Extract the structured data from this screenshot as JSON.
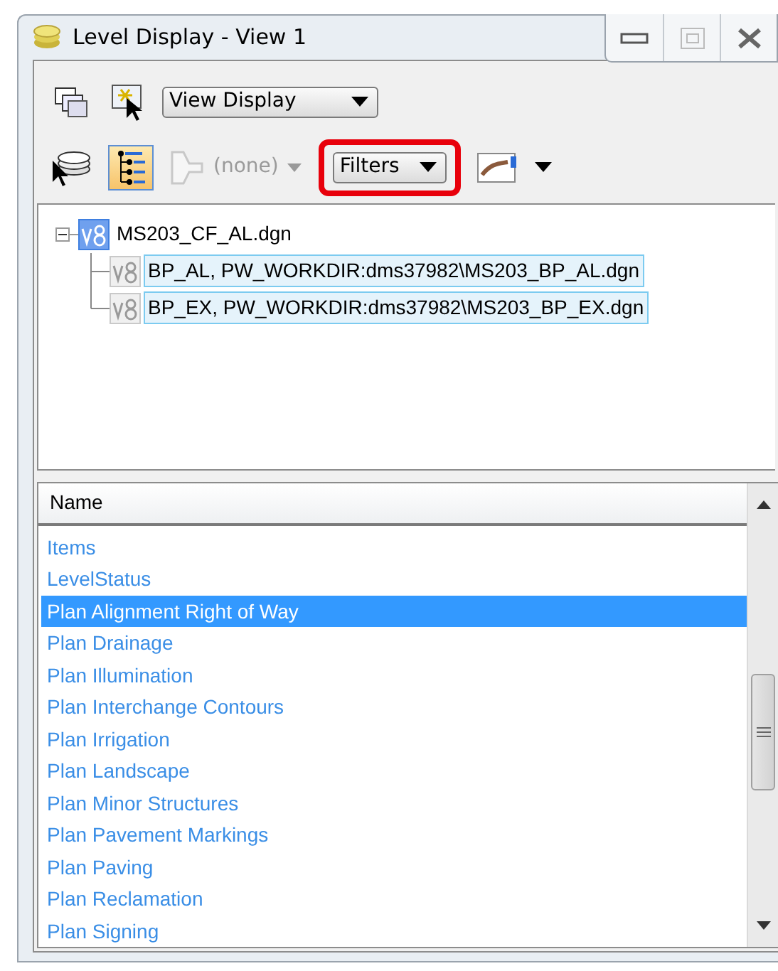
{
  "window": {
    "title": "Level Display - View 1"
  },
  "toolbar_1": {
    "display_select": {
      "value": "View Display"
    }
  },
  "toolbar_2": {
    "tree_toggle": {
      "on": true
    },
    "filter_select": {
      "value": "(none)",
      "disabled": true
    },
    "filters_menu": {
      "label": "Filters",
      "highlighted": true
    }
  },
  "tree": {
    "label": "MS203_CF_AL.dgn",
    "expanded": true,
    "selected": false,
    "children": [
      {
        "label": "BP_AL, PW_WORKDIR:dms37982\\MS203_BP_AL.dgn",
        "selected": true
      },
      {
        "label": "BP_EX, PW_WORKDIR:dms37982\\MS203_BP_EX.dgn",
        "selected": true
      }
    ]
  },
  "list": {
    "columns": [
      "Name"
    ],
    "rows": [
      {
        "name": "Items",
        "selected": false
      },
      {
        "name": "LevelStatus",
        "selected": false
      },
      {
        "name": "Plan Alignment Right of Way",
        "selected": true
      },
      {
        "name": "Plan Drainage",
        "selected": false
      },
      {
        "name": "Plan Illumination",
        "selected": false
      },
      {
        "name": "Plan Interchange Contours",
        "selected": false
      },
      {
        "name": "Plan Irrigation",
        "selected": false
      },
      {
        "name": "Plan Landscape",
        "selected": false
      },
      {
        "name": "Plan Minor Structures",
        "selected": false
      },
      {
        "name": "Plan Pavement Markings",
        "selected": false
      },
      {
        "name": "Plan Paving",
        "selected": false
      },
      {
        "name": "Plan Reclamation",
        "selected": false
      },
      {
        "name": "Plan Signing",
        "selected": false
      }
    ]
  }
}
